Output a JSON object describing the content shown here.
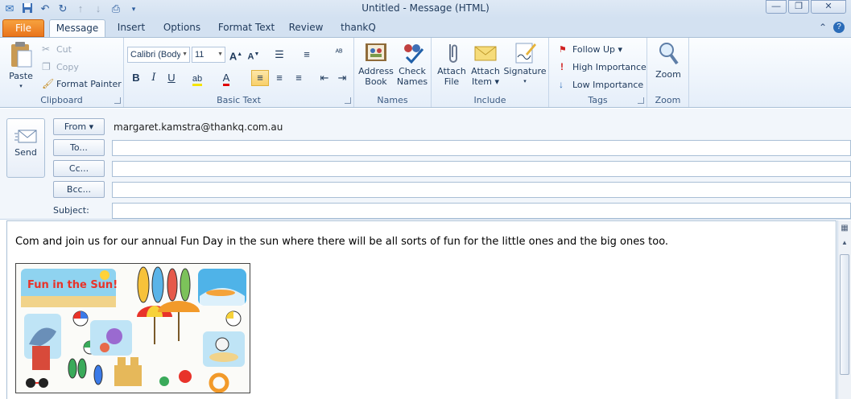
{
  "window": {
    "title": "Untitled  -  Message (HTML)",
    "minimize": "—",
    "restore": "❐",
    "close": "✕"
  },
  "qat": {
    "save_icon": "save-icon",
    "undo_icon": "undo-icon",
    "redo_icon": "redo-icon"
  },
  "tabs": [
    {
      "label": "File"
    },
    {
      "label": "Message"
    },
    {
      "label": "Insert"
    },
    {
      "label": "Options"
    },
    {
      "label": "Format Text"
    },
    {
      "label": "Review"
    },
    {
      "label": "thankQ"
    }
  ],
  "ribbon": {
    "clipboard": {
      "label": "Clipboard",
      "paste": "Paste",
      "cut": "Cut",
      "copy": "Copy",
      "format_painter": "Format Painter"
    },
    "basic_text": {
      "label": "Basic Text",
      "font_name": "Calibri (Body)",
      "font_size": "11",
      "bold": "B",
      "italic": "I",
      "underline": "U"
    },
    "names": {
      "label": "Names",
      "address_book_1": "Address",
      "address_book_2": "Book",
      "check_names_1": "Check",
      "check_names_2": "Names"
    },
    "include": {
      "label": "Include",
      "attach_file_1": "Attach",
      "attach_file_2": "File",
      "attach_item_1": "Attach",
      "attach_item_2": "Item ▾",
      "signature": "Signature"
    },
    "tags": {
      "label": "Tags",
      "follow_up": "Follow Up ▾",
      "high_importance": "High Importance",
      "low_importance": "Low Importance"
    },
    "zoom": {
      "label": "Zoom",
      "zoom_btn": "Zoom"
    }
  },
  "header": {
    "send": "Send",
    "from_btn": "From ▾",
    "from_address": "margaret.kamstra@thankq.com.au",
    "to_btn": "To...",
    "cc_btn": "Cc...",
    "bcc_btn": "Bcc...",
    "subject_label": "Subject:",
    "to_value": "",
    "cc_value": "",
    "bcc_value": "",
    "subject_value": ""
  },
  "message": {
    "body_text": "Com and join us for our annual Fun Day in the sun where there will be all sorts of fun for the little ones and the big ones too.",
    "picture_caption": "Fun in the Sun!"
  },
  "colors": {
    "file_tab": "#e9741c",
    "ribbon_bg": "#e5eef9",
    "accent": "#1e395b"
  }
}
